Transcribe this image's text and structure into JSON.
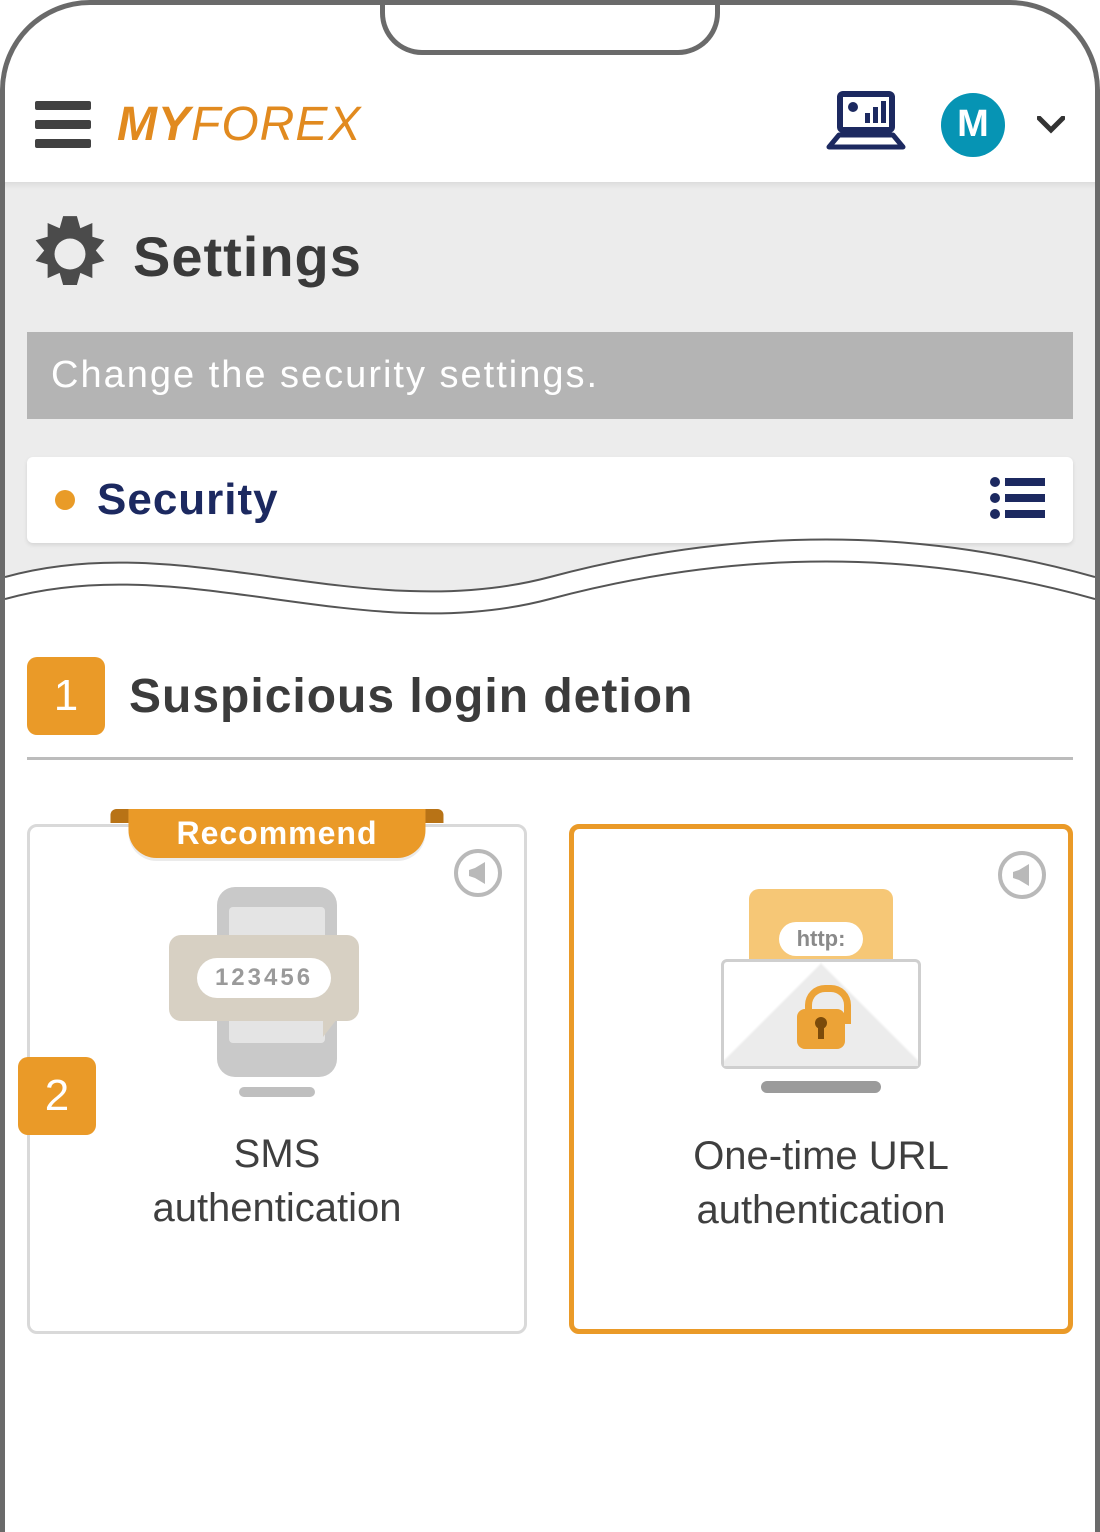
{
  "header": {
    "logo_part1": "MY",
    "logo_part2": "FOREX",
    "avatar_initial": "M"
  },
  "settings": {
    "title": "Settings",
    "subtitle": "Change the security settings."
  },
  "security_row": {
    "label": "Security"
  },
  "section": {
    "step_number": "1",
    "title": "Suspicious login detion"
  },
  "cards": {
    "sms": {
      "step_number": "2",
      "ribbon": "Recommend",
      "code_sample": "123456",
      "title_line1": "SMS",
      "title_line2": "authentication"
    },
    "url": {
      "url_pill": "http:",
      "title_line1": "One-time URL",
      "title_line2": "authentication"
    }
  }
}
